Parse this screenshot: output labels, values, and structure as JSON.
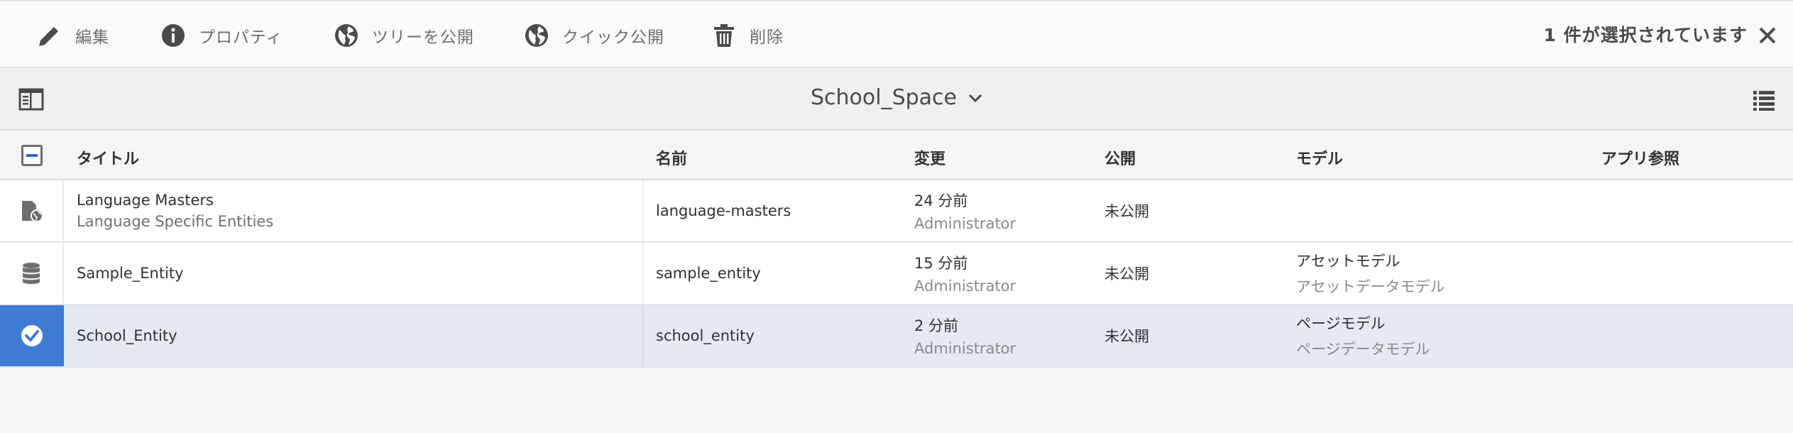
{
  "actionbar": {
    "actions": [
      {
        "label": "編集",
        "icon": "pencil-icon"
      },
      {
        "label": "プロパティ",
        "icon": "info-icon"
      },
      {
        "label": "ツリーを公開",
        "icon": "globe-icon"
      },
      {
        "label": "クイック公開",
        "icon": "globe-icon"
      },
      {
        "label": "削除",
        "icon": "trash-icon"
      }
    ],
    "selection_text": "1 件が選択されています",
    "close_icon": "close-icon"
  },
  "titlebar": {
    "title": "School_Space",
    "rail_icon": "rail-toggle-icon",
    "view_icon": "list-view-icon"
  },
  "table": {
    "columns": [
      "タイトル",
      "名前",
      "変更",
      "公開",
      "モデル",
      "アプリ参照"
    ],
    "rows": [
      {
        "icon": "folder-globe-icon",
        "title": "Language Masters",
        "subtitle": "Language Specific Entities",
        "name": "language-masters",
        "modified": "24 分前",
        "modified_by": "Administrator",
        "published": "未公開",
        "model": "",
        "model_sub": "",
        "selected": false
      },
      {
        "icon": "database-icon",
        "title": "Sample_Entity",
        "subtitle": "",
        "name": "sample_entity",
        "modified": "15 分前",
        "modified_by": "Administrator",
        "published": "未公開",
        "model": "アセットモデル",
        "model_sub": "アセットデータモデル",
        "selected": false
      },
      {
        "icon": "checkmark-circle-icon",
        "title": "School_Entity",
        "subtitle": "",
        "name": "school_entity",
        "modified": "2 分前",
        "modified_by": "Administrator",
        "published": "未公開",
        "model": "ページモデル",
        "model_sub": "ページデータモデル",
        "selected": true
      }
    ]
  },
  "colors": {
    "selection_accent": "#3f7ad3",
    "selected_row": "#e4e9f2"
  }
}
